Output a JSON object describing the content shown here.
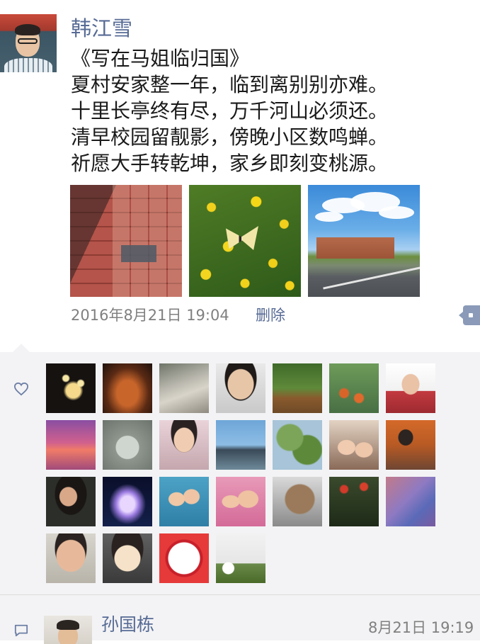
{
  "post": {
    "author": "韩江雪",
    "poem_lines": [
      "《写在马姐临归国》",
      "夏村安家整一年，临到离别别亦难。",
      "十里长亭终有尽，万千河山必须还。",
      "清早校园留靓影，傍晚小区数鸣蝉。",
      "祈愿大手转乾坤，家乡即刻变桃源。"
    ],
    "photos": [
      "brick-pavement-shadow",
      "butterfly-on-yellow-flowers",
      "campus-building-road"
    ],
    "timestamp": "2016年8月21日 19:04",
    "delete_label": "删除",
    "colors": {
      "link": "#576b95",
      "meta": "#808080",
      "panel": "#f3f3f5"
    }
  },
  "likes": {
    "icon": "heart-icon",
    "avatar_count": 25
  },
  "comment": {
    "icon": "comment-bubble-icon",
    "author": "孙国栋",
    "time": "8月21日 19:19"
  }
}
